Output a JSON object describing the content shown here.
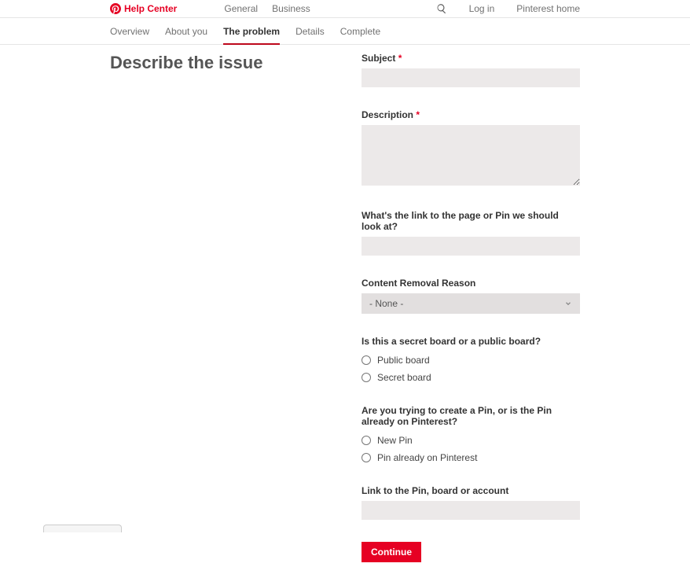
{
  "header": {
    "logo_text": "Help Center",
    "nav": {
      "general": "General",
      "business": "Business"
    },
    "login": "Log in",
    "home": "Pinterest home"
  },
  "tabs": {
    "overview": "Overview",
    "about_you": "About you",
    "the_problem": "The problem",
    "details": "Details",
    "complete": "Complete"
  },
  "page_title": "Describe the issue",
  "form": {
    "subject": {
      "label": "Subject"
    },
    "description": {
      "label": "Description"
    },
    "link_page": {
      "label": "What's the link to the page or Pin we should look at?"
    },
    "removal_reason": {
      "label": "Content Removal Reason",
      "selected": "- None -"
    },
    "board_type": {
      "label": "Is this a secret board or a public board?",
      "options": {
        "public": "Public board",
        "secret": "Secret board"
      }
    },
    "pin_status": {
      "label": "Are you trying to create a Pin, or is the Pin already on Pinterest?",
      "options": {
        "new": "New Pin",
        "existing": "Pin already on Pinterest"
      }
    },
    "link_pin": {
      "label": "Link to the Pin, board or account"
    },
    "continue": "Continue"
  },
  "colors": {
    "brand": "#e60023",
    "input_bg": "#ece9e9"
  }
}
